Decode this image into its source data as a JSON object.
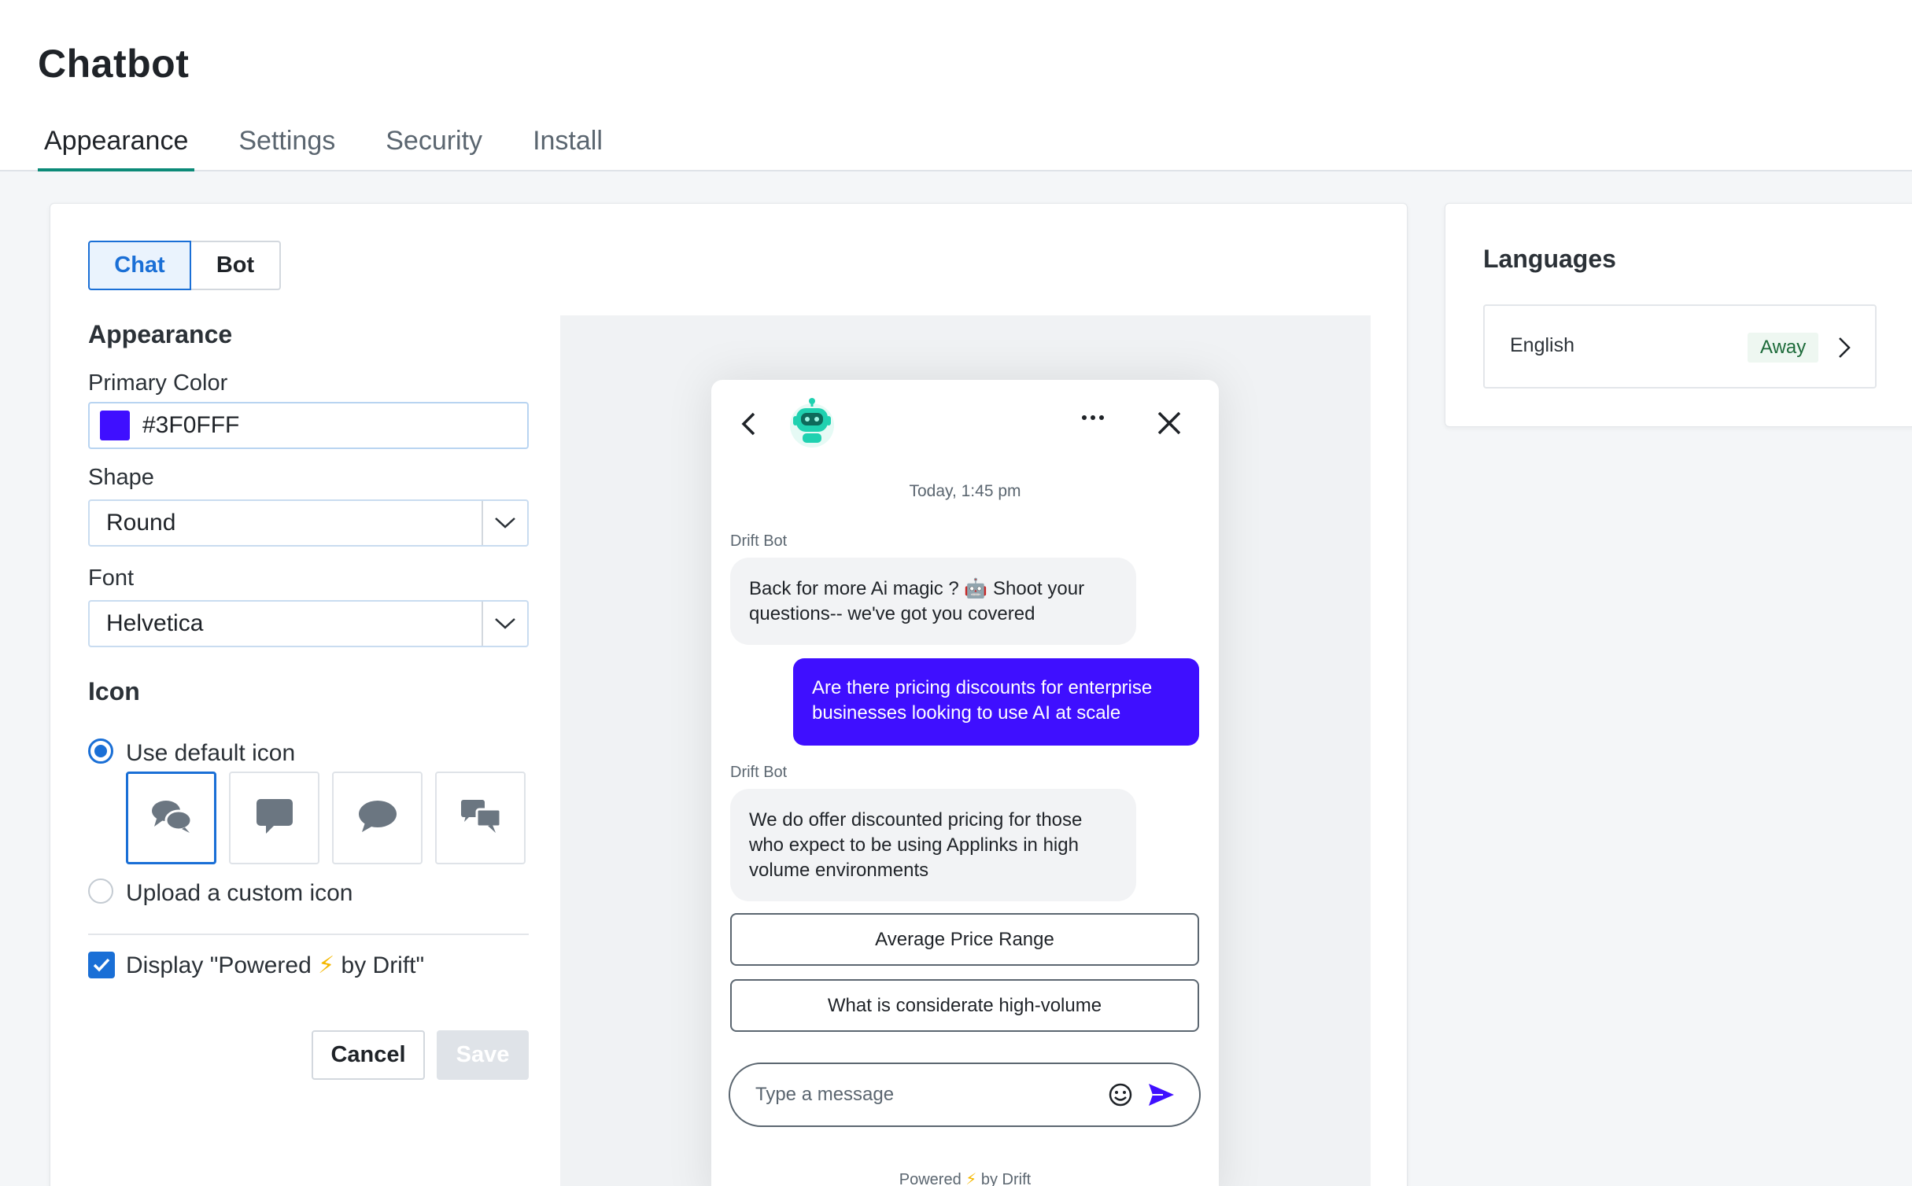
{
  "page": {
    "title": "Chatbot",
    "tabs": [
      {
        "label": "Appearance",
        "active": true
      },
      {
        "label": "Settings",
        "active": false
      },
      {
        "label": "Security",
        "active": false
      },
      {
        "label": "Install",
        "active": false
      }
    ]
  },
  "form": {
    "segments": [
      {
        "label": "Chat",
        "active": true
      },
      {
        "label": "Bot",
        "active": false
      }
    ],
    "appearance_heading": "Appearance",
    "primary_color_label": "Primary Color",
    "primary_color_value": "#3F0FFF",
    "shape_label": "Shape",
    "shape_value": "Round",
    "font_label": "Font",
    "font_value": "Helvetica",
    "icon_heading": "Icon",
    "use_default_icon_label": "Use default icon",
    "upload_custom_icon_label": "Upload a custom icon",
    "icon_options": [
      "chat-bubbles-icon",
      "square-bubble-icon",
      "round-bubble-icon",
      "double-square-bubble-icon"
    ],
    "display_powered_label_before": "Display \"Powered ",
    "display_powered_bolt": "⚡",
    "display_powered_label_after": " by Drift\"",
    "display_powered_checked": true,
    "cancel_label": "Cancel",
    "save_label": "Save"
  },
  "preview": {
    "timestamp": "Today, 1:45 pm",
    "messages": [
      {
        "sender": "Drift Bot",
        "text": "Back for more Ai magic ? 🤖 Shoot your questions-- we've got you covered",
        "from": "bot"
      },
      {
        "text": "Are there pricing discounts for enterprise businesses looking to use AI at scale",
        "from": "user"
      },
      {
        "sender": "Drift Bot",
        "text": "We do offer discounted pricing for those who expect to be using Applinks in high volume environments",
        "from": "bot"
      }
    ],
    "quick_replies": [
      "Average Price Range",
      "What is considerate high-volume"
    ],
    "composer_placeholder": "Type a message",
    "powered_before": "Powered ",
    "powered_bolt": "⚡",
    "powered_after": " by Drift"
  },
  "languages": {
    "title": "Languages",
    "items": [
      {
        "name": "English",
        "status": "Away"
      }
    ]
  },
  "colors": {
    "accent": "#1a6fd6",
    "tab_underline": "#0b8a78",
    "primary_brand": "#3F0FFF",
    "bot_teal": "#1fd1b0"
  }
}
